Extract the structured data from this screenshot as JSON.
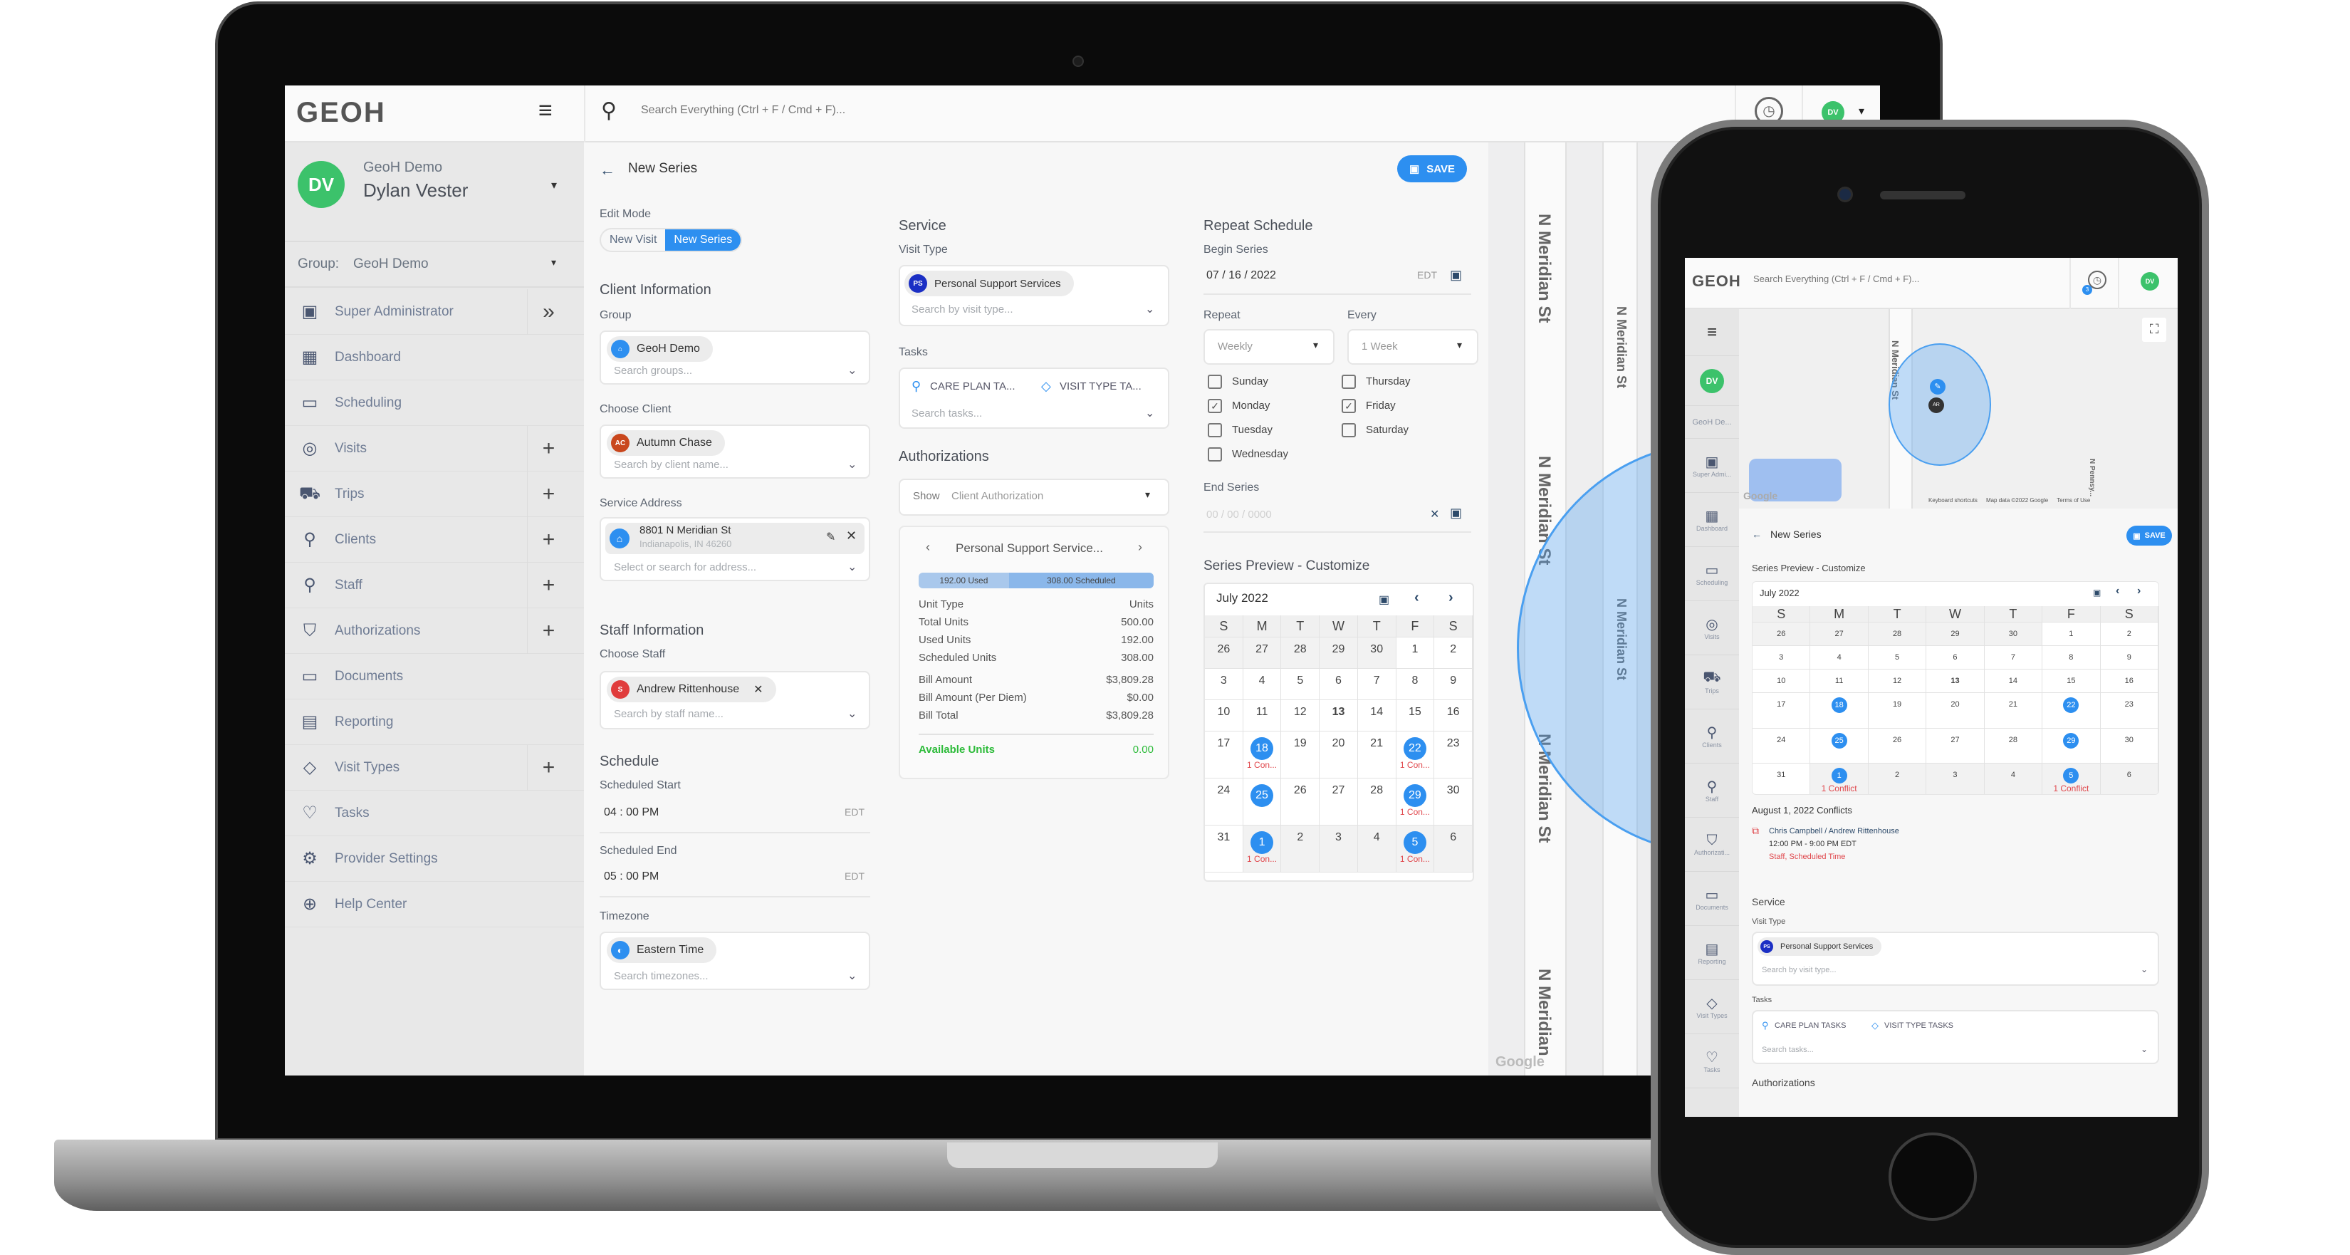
{
  "app": {
    "brand": "GEOH",
    "search_placeholder": "Search Everything (Ctrl + F / Cmd + F)...",
    "notification_count": "3",
    "avatar_initials": "DV",
    "brand_color": "#2d8ff0",
    "avatar_color": "#3cc26b",
    "conflict_color": "#e0474c",
    "available_color": "#2dbb3a"
  },
  "sidebar": {
    "user_org": "GeoH Demo",
    "user_name": "Dylan Vester",
    "group_label": "Group:",
    "group_value": "GeoH Demo",
    "items": [
      {
        "label": "Super Administrator",
        "icon": "id-badge-icon",
        "glyph": "▣",
        "action": "»"
      },
      {
        "label": "Dashboard",
        "icon": "dashboard-grid-icon",
        "glyph": "▦",
        "action": ""
      },
      {
        "label": "Scheduling",
        "icon": "calendar-icon",
        "glyph": "▭",
        "action": ""
      },
      {
        "label": "Visits",
        "icon": "location-pin-icon",
        "glyph": "◎",
        "action": "+"
      },
      {
        "label": "Trips",
        "icon": "car-icon",
        "glyph": "⛟",
        "action": "+"
      },
      {
        "label": "Clients",
        "icon": "client-icon",
        "glyph": "⚲",
        "action": "+"
      },
      {
        "label": "Staff",
        "icon": "staff-icon",
        "glyph": "⚲",
        "action": "+"
      },
      {
        "label": "Authorizations",
        "icon": "shield-icon",
        "glyph": "⛉",
        "action": "+"
      },
      {
        "label": "Documents",
        "icon": "folder-icon",
        "glyph": "▭",
        "action": ""
      },
      {
        "label": "Reporting",
        "icon": "report-icon",
        "glyph": "▤",
        "action": ""
      },
      {
        "label": "Visit Types",
        "icon": "tag-icon",
        "glyph": "◇",
        "action": "+"
      },
      {
        "label": "Tasks",
        "icon": "heart-hand-icon",
        "glyph": "♡",
        "action": ""
      },
      {
        "label": "Provider Settings",
        "icon": "gear-icon",
        "glyph": "⚙",
        "action": ""
      },
      {
        "label": "Help Center",
        "icon": "lifebuoy-icon",
        "glyph": "⊕",
        "action": ""
      }
    ]
  },
  "page": {
    "title": "New Series",
    "save_label": "SAVE",
    "edit_mode": {
      "label": "Edit Mode",
      "options": [
        "New Visit",
        "New Series"
      ],
      "selected": "New Series"
    },
    "client_info": {
      "title": "Client Information",
      "group_label": "Group",
      "group_chip": "GeoH Demo",
      "group_placeholder": "Search groups...",
      "client_label": "Choose Client",
      "client_chip": "Autumn Chase",
      "client_initials": "AC",
      "client_placeholder": "Search by client name...",
      "address_label": "Service Address",
      "address_line1": "8801 N Meridian St",
      "address_line2": "Indianapolis, IN 46260",
      "address_placeholder": "Select or search for address..."
    },
    "staff_info": {
      "title": "Staff Information",
      "staff_label": "Choose Staff",
      "staff_chip": "Andrew Rittenhouse",
      "staff_initials": "S",
      "staff_placeholder": "Search by staff name..."
    },
    "schedule": {
      "title": "Schedule",
      "start_label": "Scheduled Start",
      "start_value": "04 : 00  PM",
      "end_label": "Scheduled End",
      "end_value": "05 : 00  PM",
      "tz_abbr": "EDT",
      "timezone_label": "Timezone",
      "timezone_chip": "Eastern Time",
      "timezone_placeholder": "Search timezones..."
    },
    "service": {
      "title": "Service",
      "visit_type_label": "Visit Type",
      "visit_type_chip": "Personal Support Services",
      "visit_type_initials": "PS",
      "visit_type_placeholder": "Search by visit type...",
      "tasks_label": "Tasks",
      "task_care_plan": "CARE PLAN TA...",
      "task_visit_type": "VISIT TYPE TA...",
      "tasks_placeholder": "Search tasks..."
    },
    "authorizations": {
      "title": "Authorizations",
      "show_label": "Show",
      "show_value": "Client Authorization",
      "card_title": "Personal Support Service...",
      "used_label": "192.00 Used",
      "scheduled_label": "308.00 Scheduled",
      "used_fraction": 0.384,
      "rows": [
        {
          "label": "Unit Type",
          "value": "Units"
        },
        {
          "label": "Total Units",
          "value": "500.00"
        },
        {
          "label": "Used Units",
          "value": "192.00"
        },
        {
          "label": "Scheduled Units",
          "value": "308.00"
        }
      ],
      "bill_rows": [
        {
          "label": "Bill Amount",
          "value": "$3,809.28"
        },
        {
          "label": "Bill Amount (Per Diem)",
          "value": "$0.00"
        },
        {
          "label": "Bill Total",
          "value": "$3,809.28"
        }
      ],
      "available_label": "Available Units",
      "available_value": "0.00"
    },
    "repeat": {
      "title": "Repeat Schedule",
      "begin_label": "Begin Series",
      "begin_value": "07 / 16 / 2022",
      "begin_tz": "EDT",
      "repeat_label": "Repeat",
      "repeat_value": "Weekly",
      "every_label": "Every",
      "every_value": "1 Week",
      "days": [
        {
          "label": "Sunday",
          "checked": false
        },
        {
          "label": "Monday",
          "checked": true
        },
        {
          "label": "Tuesday",
          "checked": false
        },
        {
          "label": "Wednesday",
          "checked": false
        },
        {
          "label": "Thursday",
          "checked": false
        },
        {
          "label": "Friday",
          "checked": true
        },
        {
          "label": "Saturday",
          "checked": false
        }
      ],
      "end_label": "End Series",
      "end_placeholder": "00 / 00 / 0000"
    },
    "preview": {
      "title": "Series Preview - Customize",
      "month": "July 2022",
      "weekdays": [
        "S",
        "M",
        "T",
        "W",
        "T",
        "F",
        "S"
      ],
      "weeks": [
        [
          {
            "d": "26",
            "o": 1
          },
          {
            "d": "27",
            "o": 1
          },
          {
            "d": "28",
            "o": 1
          },
          {
            "d": "29",
            "o": 1
          },
          {
            "d": "30",
            "o": 1
          },
          {
            "d": "1"
          },
          {
            "d": "2"
          }
        ],
        [
          {
            "d": "3"
          },
          {
            "d": "4"
          },
          {
            "d": "5"
          },
          {
            "d": "6"
          },
          {
            "d": "7"
          },
          {
            "d": "8"
          },
          {
            "d": "9"
          }
        ],
        [
          {
            "d": "10"
          },
          {
            "d": "11"
          },
          {
            "d": "12"
          },
          {
            "d": "13",
            "b": 1
          },
          {
            "d": "14"
          },
          {
            "d": "15"
          },
          {
            "d": "16"
          }
        ],
        [
          {
            "d": "17"
          },
          {
            "d": "18",
            "s": 1,
            "c": "1 Con..."
          },
          {
            "d": "19"
          },
          {
            "d": "20"
          },
          {
            "d": "21"
          },
          {
            "d": "22",
            "s": 1,
            "c": "1 Con..."
          },
          {
            "d": "23"
          }
        ],
        [
          {
            "d": "24"
          },
          {
            "d": "25",
            "s": 1
          },
          {
            "d": "26"
          },
          {
            "d": "27"
          },
          {
            "d": "28"
          },
          {
            "d": "29",
            "s": 1,
            "c": "1 Con..."
          },
          {
            "d": "30"
          }
        ],
        [
          {
            "d": "31"
          },
          {
            "d": "1",
            "s": 1,
            "o": 1,
            "c": "1 Con..."
          },
          {
            "d": "2",
            "o": 1
          },
          {
            "d": "3",
            "o": 1
          },
          {
            "d": "4",
            "o": 1
          },
          {
            "d": "5",
            "s": 1,
            "o": 1,
            "c": "1 Con..."
          },
          {
            "d": "6",
            "o": 1
          }
        ]
      ]
    }
  },
  "map": {
    "streets": [
      "N Meridian St",
      "N Meridian St",
      "N Meridian St",
      "N Meridian St",
      "N Meridian St",
      "N Meridian"
    ],
    "attribution": "Google",
    "footer": [
      "Keyboard shortcuts",
      "Map data ©2022 Google",
      "Terms of Use"
    ]
  },
  "phone": {
    "sidebar_user": "GeoH De...",
    "nav": [
      {
        "label": "Super Admi...",
        "icon": "id-badge-icon",
        "glyph": "▣"
      },
      {
        "label": "Dashboard",
        "icon": "dashboard-grid-icon",
        "glyph": "▦"
      },
      {
        "label": "Scheduling",
        "icon": "calendar-icon",
        "glyph": "▭"
      },
      {
        "label": "Visits",
        "icon": "location-pin-icon",
        "glyph": "◎"
      },
      {
        "label": "Trips",
        "icon": "car-icon",
        "glyph": "⛟"
      },
      {
        "label": "Clients",
        "icon": "client-icon",
        "glyph": "⚲"
      },
      {
        "label": "Staff",
        "icon": "staff-icon",
        "glyph": "⚲"
      },
      {
        "label": "Authorizati...",
        "icon": "shield-icon",
        "glyph": "⛉"
      },
      {
        "label": "Documents",
        "icon": "folder-icon",
        "glyph": "▭"
      },
      {
        "label": "Reporting",
        "icon": "report-icon",
        "glyph": "▤"
      },
      {
        "label": "Visit Types",
        "icon": "tag-icon",
        "glyph": "◇"
      },
      {
        "label": "Tasks",
        "icon": "heart-hand-icon",
        "glyph": "♡"
      }
    ],
    "map_street_1": "N Meridian St",
    "map_street_2": "N Pennsy...",
    "map_marker_initials": "AR",
    "conflict_count_label": "1 Conflict",
    "conflicts_title": "August 1, 2022 Conflicts",
    "conflict": {
      "names": "Chris Campbell / Andrew Rittenhouse",
      "time": "12:00 PM - 9:00 PM EDT",
      "reason": "Staff, Scheduled Time"
    },
    "task_care_plan": "CARE PLAN TASKS",
    "task_visit_type": "VISIT TYPE TASKS",
    "authorizations_title": "Authorizations"
  }
}
